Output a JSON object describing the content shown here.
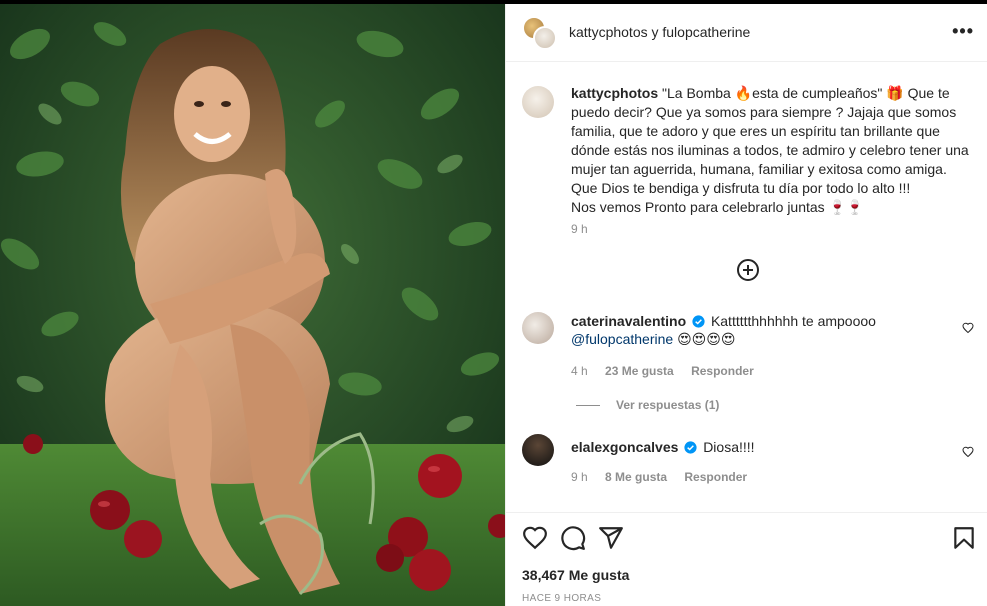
{
  "header": {
    "title": "kattycphotos y fulopcatherine",
    "more_icon": "more-horizontal-icon"
  },
  "caption": {
    "username": "kattycphotos",
    "text_lines": [
      "\"La Bomba 🔥esta de cumpleaños\" 🎁 Que te puedo decir? Que ya somos para siempre ? Jajaja que somos familia, que te adoro y que eres un espíritu tan brillante que dónde estás nos iluminas a todos, te admiro y celebro tener una mujer tan aguerrida, humana, familiar y exitosa como amiga.",
      "Que Dios te bendiga y disfruta tu día por todo lo alto !!!",
      "Nos vemos Pronto para celebrarlo juntas 🍷🍷"
    ],
    "time": "9 h"
  },
  "load_more_icon": "plus-circle-icon",
  "comments": [
    {
      "username": "caterinavalentino",
      "verified": true,
      "text": "Katttttthhhhhh te ampoooo",
      "mention": "@fulopcatherine",
      "emojis": "😍😍😍😍",
      "time": "4 h",
      "likes": "23 Me gusta",
      "reply": "Responder",
      "view_replies": "Ver respuestas (1)"
    },
    {
      "username": "elalexgoncalves",
      "verified": true,
      "text": "Diosa!!!!",
      "time": "9 h",
      "likes": "8 Me gusta",
      "reply": "Responder"
    }
  ],
  "actions": {
    "icons": [
      "heart-icon",
      "comment-icon",
      "share-icon",
      "bookmark-icon"
    ],
    "likes": "38,467 Me gusta",
    "ago": "HACE 9 HORAS"
  },
  "colors": {
    "text": "#262626",
    "muted": "#8e8e8e",
    "mention": "#00376b",
    "verified": "#0095f6",
    "border": "#efefef"
  }
}
